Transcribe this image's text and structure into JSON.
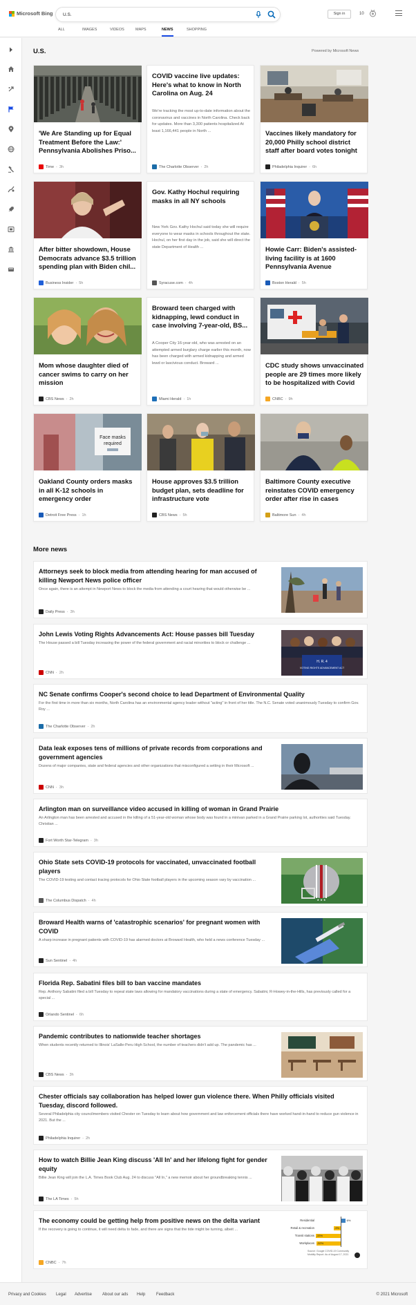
{
  "brand": {
    "name": "Microsoft Bing"
  },
  "search": {
    "query": "U.S."
  },
  "header": {
    "signin": "Sign in",
    "rewards_count": "10"
  },
  "tabs": [
    "ALL",
    "IMAGES",
    "VIDEOS",
    "MAPS",
    "NEWS",
    "SHOPPING"
  ],
  "active_tab": "NEWS",
  "page": {
    "title": "U.S.",
    "powered": "Powered by Microsoft News"
  },
  "cards": [
    {
      "title": "'We Are Standing up for Equal Treatment Before the Law:' Pennsylvania Abolishes Priso...",
      "source": "Time",
      "age": "3h",
      "image": "prison-cells"
    },
    {
      "title": "COVID vaccine live updates: Here's what to know in North Carolina on Aug. 24",
      "summary": "We're tracking the most up-to-date information about the coronavirus and vaccines in North Carolina. Check back for updates. More than 3,300 patients hospitalized At least 1,166,441 people in North ...",
      "source": "The Charlotte Observer",
      "age": "2h"
    },
    {
      "title": "Vaccines likely mandatory for 20,000 Philly school district staff after board votes tonight",
      "source": "Philadelphia Inquirer",
      "age": "6h",
      "image": "board-meeting"
    },
    {
      "title": "After bitter showdown, House Democrats advance $3.5 trillion spending plan with Biden chil...",
      "source": "Business Insider",
      "age": "5h",
      "image": "speaker-portrait"
    },
    {
      "title": "Gov. Kathy Hochul requiring masks in all NY schools",
      "summary": "New York Gov. Kathy Hochul said today she will require everyone to wear masks in schools throughout the state. Hochul, on her first day in the job, said she will direct the state Department of Health ...",
      "source": "Syracuse.com",
      "age": "4h"
    },
    {
      "title": "Howie Carr: Biden's assisted-living facility is at 1600 Pennsylvania Avenue",
      "source": "Boston Herald",
      "age": "5h",
      "image": "president-podium"
    },
    {
      "title": "Mom whose daughter died of cancer swims to carry on her mission",
      "source": "CBS News",
      "age": "2h",
      "image": "mother-daughter"
    },
    {
      "title": "Broward teen charged with kidnapping, lewd conduct in case involving 7-year-old, BS...",
      "summary": "A Cooper City 16-year-old, who was arrested on an attempted armed burglary charge earlier this month, now has been charged with armed kidnapping and armed lewd or lascivious conduct. Broward ...",
      "source": "Miami Herald",
      "age": "1h"
    },
    {
      "title": "CDC study shows unvaccinated people are 29 times more likely to be hospitalized with Covid",
      "source": "CNBC",
      "age": "9h",
      "image": "ambulance"
    },
    {
      "title": "Oakland County orders masks in all K-12 schools in emergency order",
      "source": "Detroit Free Press",
      "age": "1h",
      "image": "mask-sign"
    },
    {
      "title": "House approves $3.5 trillion budget plan, sets deadline for infrastructure vote",
      "source": "CBS News",
      "age": "5h",
      "image": "pelosi-walk"
    },
    {
      "title": "Baltimore County executive reinstates COVID emergency order after rise in cases",
      "source": "Baltimore Sun",
      "age": "4h",
      "image": "executive-masked"
    }
  ],
  "more_news_heading": "More news",
  "more_news": [
    {
      "title": "Attorneys seek to block media from attending hearing for man accused of killing Newport News police officer",
      "summary": "Once again, there is an attempt in Newport News to block the media from attending a court hearing that would otherwise be ...",
      "source": "Daily Press",
      "age": "3h",
      "image": "outdoor-memorial"
    },
    {
      "title": "John Lewis Voting Rights Advancements Act: House passes bill Tuesday",
      "summary": "The House passed a bill Tuesday increasing the power of the federal government and racial minorities to block or challenge ...",
      "source": "CNN",
      "age": "2h",
      "image": "voting-rights-podium"
    },
    {
      "title": "NC Senate confirms Cooper's second choice to lead Department of Environmental Quality",
      "summary": "For the first time in more than six months, North Carolina has an environmental agency leader without \"acting\" in front of her title. The N.C. Senate voted unanimously Tuesday to confirm Gov. Roy ...",
      "source": "The Charlotte Observer",
      "age": "2h"
    },
    {
      "title": "Data leak exposes tens of millions of private records from corporations and government agencies",
      "summary": "Dozens of major companies, state and federal agencies and other organizations that misconfigured a setting in their Microsoft ...",
      "source": "CNN",
      "age": "3h",
      "image": "silhouette-airport"
    },
    {
      "title": "Arlington man on surveillance video accused in killing of woman in Grand Prairie",
      "summary": "An Arlington man has been arrested and accused in the killing of a 51-year-old woman whose body was found in a minivan parked in a Grand Prairie parking lot, authorities said Tuesday. Christian ...",
      "source": "Fort Worth Star-Telegram",
      "age": "3h"
    },
    {
      "title": "Ohio State sets COVID-19 protocols for vaccinated, unvaccinated football players",
      "summary": "The COVID-19 testing and contact tracing protocols for Ohio State football players in the upcoming season vary by vaccination ...",
      "source": "The Columbus Dispatch",
      "age": "4h",
      "image": "football-helmet"
    },
    {
      "title": "Broward Health warns of 'catastrophic scenarios' for pregnant women with COVID",
      "summary": "A sharp increase in pregnant patients with COVID-19 has alarmed doctors at Broward Health, who held a news conference Tuesday ...",
      "source": "Sun Sentinel",
      "age": "4h",
      "image": "vaccine-injection"
    },
    {
      "title": "Florida Rep. Sabatini files bill to ban vaccine mandates",
      "summary": "Rep. Anthony Sabatini filed a bill Tuesday to repeal state laws allowing for mandatory vaccinations during a state of emergency. Sabatini, R-Howey-in-the-Hills, has previously called for a special ...",
      "source": "Orlando Sentinel",
      "age": "6h"
    },
    {
      "title": "Pandemic contributes to nationwide teacher shortages",
      "summary": "When students recently returned to Illinois' LaSalle-Peru High School, the number of teachers didn't add up. The pandemic has ...",
      "source": "CBS News",
      "age": "3h",
      "image": "classroom"
    },
    {
      "title": "Chester officials say collaboration has helped lower gun violence there. When Philly officials visited Tuesday, discord followed.",
      "summary": "Several Philadelphia city councilmembers visited Chester on Tuesday to learn about how government and law enforcement officials there have worked hand-in-hand to reduce gun violence in 2021. But the ...",
      "source": "Philadelphia Inquirer",
      "age": "2h"
    },
    {
      "title": "How to watch Billie Jean King discuss 'All In' and her lifelong fight for gender equity",
      "summary": "Billie Jean King will join the L.A. Times Book Club Aug. 24 to discuss \"All In,\" a new memoir about her groundbreaking tennis ...",
      "source": "The LA Times",
      "age": "5h",
      "image": "bw-crowd-photo"
    },
    {
      "title": "The economy could be getting help from positive news on the delta variant",
      "summary": "If the recovery is going to continue, it will need delta to fade, and there are signs that the tide might be turning, albeit ...",
      "source": "CNBC",
      "age": "7h",
      "image": "mobility-chart"
    }
  ],
  "mobility_chart": {
    "rows": [
      {
        "label": "Residential",
        "value": "6%"
      },
      {
        "label": "Retail & recreation",
        "value": "-9%"
      },
      {
        "label": "Transit stations",
        "value": "-33%"
      },
      {
        "label": "Workplaces",
        "value": "-32%"
      }
    ],
    "footnote": "Source: Google COVID-19 Community Mobility Report. As of August 17, 2021"
  },
  "footer": {
    "links": [
      "Privacy and Cookies",
      "Legal",
      "Advertise",
      "About our ads",
      "Help",
      "Feedback"
    ],
    "copyright": "© 2021 Microsoft"
  },
  "colors": {
    "accent": "#174ae4",
    "search_icon": "#0067b8"
  }
}
